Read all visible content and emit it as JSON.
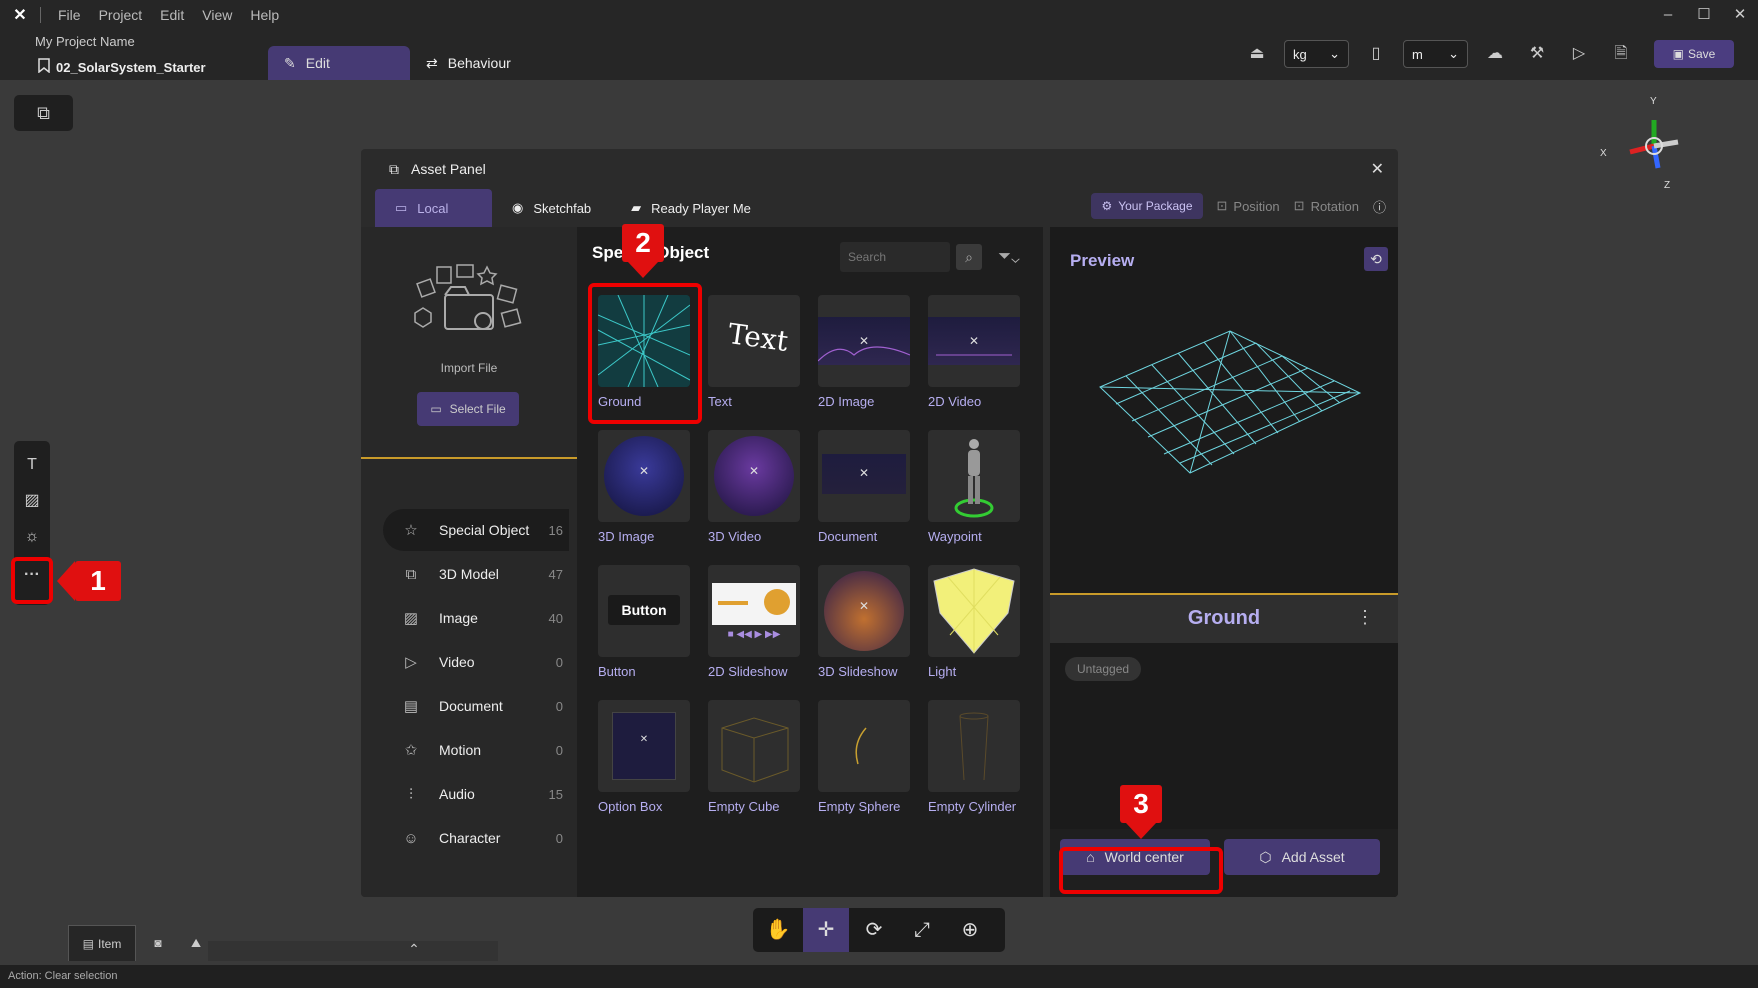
{
  "menubar": {
    "items": [
      "File",
      "Project",
      "Edit",
      "View",
      "Help"
    ],
    "window_controls": [
      "minimize-icon",
      "maximize-icon",
      "close-icon"
    ]
  },
  "project": {
    "name": "My Project Name",
    "scene": "02_SolarSystem_Starter",
    "tabs": [
      {
        "label": "Edit"
      },
      {
        "label": "Behaviour"
      }
    ]
  },
  "toolbar": {
    "mass_unit": "kg",
    "length_unit": "m",
    "save_label": "Save"
  },
  "gizmo": {
    "x": "X",
    "y": "Y",
    "z": "Z"
  },
  "annotations": {
    "m1": "1",
    "m2": "2",
    "m3": "3"
  },
  "asset_panel": {
    "title": "Asset Panel",
    "tabs": [
      "Local",
      "Sketchfab",
      "Ready Player Me"
    ],
    "package_label": "Your Package",
    "position_label": "Position",
    "rotation_label": "Rotation",
    "import_label": "Import File",
    "select_file_label": "Select File",
    "categories": [
      {
        "label": "Special Object",
        "count": "16",
        "icon": "star-icon"
      },
      {
        "label": "3D Model",
        "count": "47",
        "icon": "cube-icon"
      },
      {
        "label": "Image",
        "count": "40",
        "icon": "image-icon"
      },
      {
        "label": "Video",
        "count": "0",
        "icon": "play-icon"
      },
      {
        "label": "Document",
        "count": "0",
        "icon": "document-icon"
      },
      {
        "label": "Motion",
        "count": "0",
        "icon": "motion-icon"
      },
      {
        "label": "Audio",
        "count": "15",
        "icon": "audio-icon"
      },
      {
        "label": "Character",
        "count": "0",
        "icon": "character-icon"
      }
    ],
    "section_title": "Special Object",
    "search_placeholder": "Search",
    "items": [
      "Ground",
      "Text",
      "2D Image",
      "2D Video",
      "3D Image",
      "3D Video",
      "Document",
      "Waypoint",
      "Button",
      "2D Slideshow",
      "3D Slideshow",
      "Light",
      "Option Box",
      "Empty Cube",
      "Empty Sphere",
      "Empty Cylinder"
    ],
    "thumb_text": {
      "text": "Text",
      "button": "Button"
    },
    "preview_title": "Preview",
    "selected_name": "Ground",
    "tag": "Untagged",
    "world_center_label": "World center",
    "add_asset_label": "Add Asset"
  },
  "dock": {
    "item_label": "Item"
  },
  "status": "Action: Clear selection"
}
